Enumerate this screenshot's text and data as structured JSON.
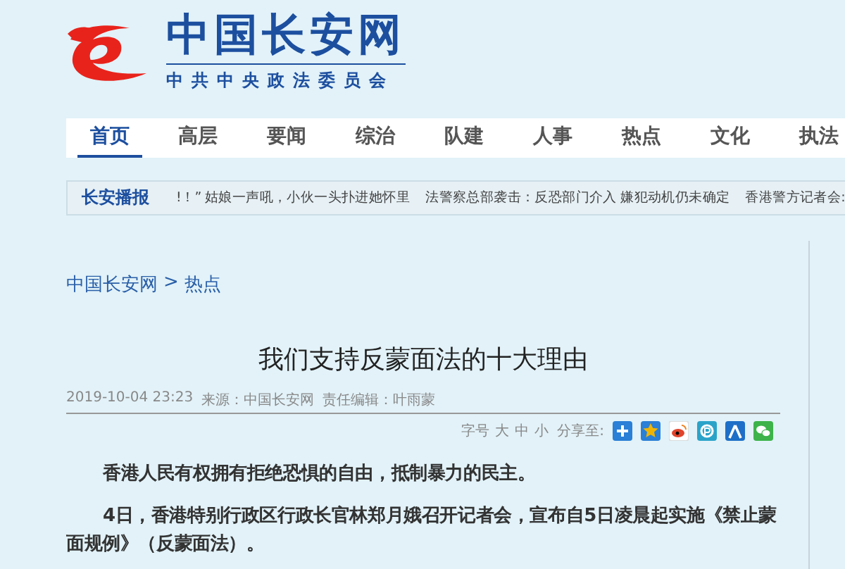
{
  "site": {
    "title": "中国长安网",
    "subtitle": "中共中央政法委员会"
  },
  "nav": [
    {
      "label": "首页",
      "selected": true
    },
    {
      "label": "高层",
      "selected": false
    },
    {
      "label": "要闻",
      "selected": false
    },
    {
      "label": "综治",
      "selected": false
    },
    {
      "label": "队建",
      "selected": false
    },
    {
      "label": "人事",
      "selected": false
    },
    {
      "label": "热点",
      "selected": false
    },
    {
      "label": "文化",
      "selected": false
    },
    {
      "label": "执法",
      "selected": false
    }
  ],
  "ticker": {
    "label": "长安播报",
    "items": [
      "!！” 姑娘一声吼，小伙一头扑进她怀里",
      "法警察总部袭击：反恐部门介入 嫌犯动机仍未确定",
      "香港警方记者会:"
    ]
  },
  "breadcrumb": {
    "items": [
      "中国长安网",
      "热点"
    ],
    "separator": ">"
  },
  "article": {
    "title": "我们支持反蒙面法的十大理由",
    "date": "2019-10-04 23:23",
    "source": "来源：中国长安网",
    "editor": "责任编辑：叶雨蒙",
    "font_size_label": "字号",
    "font_sizes": [
      "大",
      "中",
      "小"
    ],
    "share_label": "分享至:",
    "share_icons": [
      {
        "kind": "plus"
      },
      {
        "kind": "star"
      },
      {
        "kind": "weibo"
      },
      {
        "kind": "p"
      },
      {
        "kind": "person"
      },
      {
        "kind": "chat"
      }
    ],
    "paragraphs": [
      "香港人民有权拥有拒绝恐惧的自由，抵制暴力的民主。",
      "4日，香港特别行政区行政长官林郑月娥召开记者会，宣布自5日凌晨起实施《禁止蒙面规例》（反蒙面法）。"
    ]
  }
}
